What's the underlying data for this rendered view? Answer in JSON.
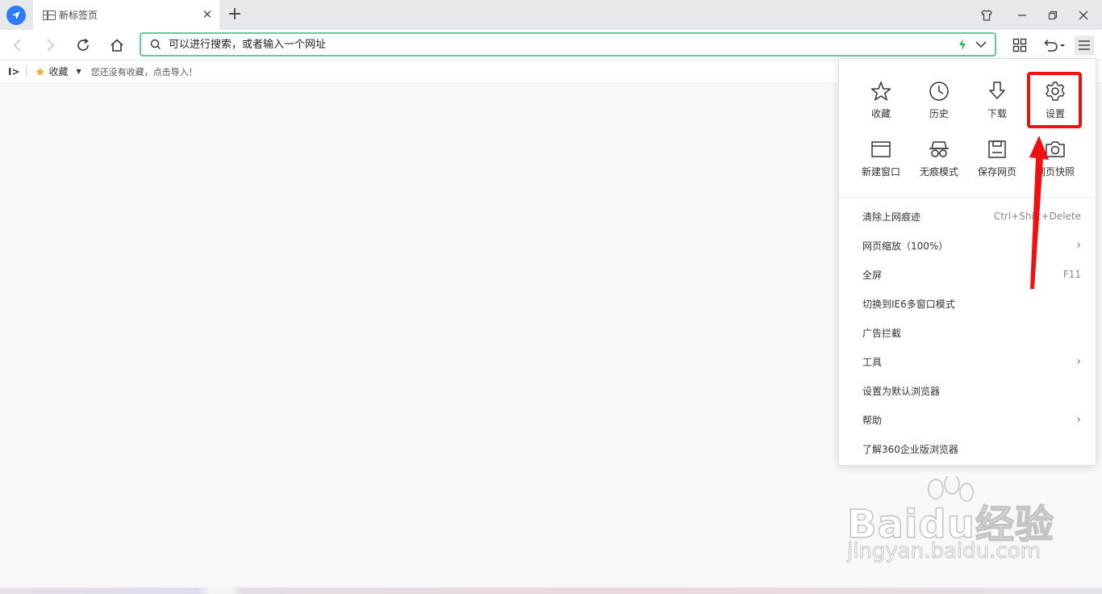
{
  "browser": {
    "tab_title": "新标签页",
    "address_placeholder": "可以进行搜索，或者输入一个网址"
  },
  "bookmarks": {
    "favorites_label": "收藏",
    "hint": "您还没有收藏，点击导入！"
  },
  "menu": {
    "quick_actions": [
      {
        "label": "收藏",
        "icon": "star-icon"
      },
      {
        "label": "历史",
        "icon": "clock-icon"
      },
      {
        "label": "下载",
        "icon": "download-icon"
      },
      {
        "label": "设置",
        "icon": "gear-icon"
      },
      {
        "label": "新建窗口",
        "icon": "window-icon"
      },
      {
        "label": "无痕模式",
        "icon": "incognito-icon"
      },
      {
        "label": "保存网页",
        "icon": "save-icon"
      },
      {
        "label": "网页快照",
        "icon": "camera-icon"
      }
    ],
    "items": [
      {
        "label": "清除上网痕迹",
        "shortcut": "Ctrl+Shift+Delete"
      },
      {
        "label": "网页缩放（100%）"
      },
      {
        "label": "全屏",
        "shortcut": "F11"
      },
      {
        "label": "切换到IE6多窗口模式"
      },
      {
        "label": "广告拦截"
      },
      {
        "label": "工具"
      },
      {
        "label": "设置为默认浏览器"
      },
      {
        "label": "帮助"
      },
      {
        "label": "了解360企业版浏览器"
      }
    ]
  },
  "watermark": {
    "brand": "Baidu经验",
    "url": "jingyan.baidu.com"
  },
  "colors": {
    "address_border": "#5ccfa0",
    "highlight": "#ee1111",
    "accent": "#2f7df6"
  }
}
